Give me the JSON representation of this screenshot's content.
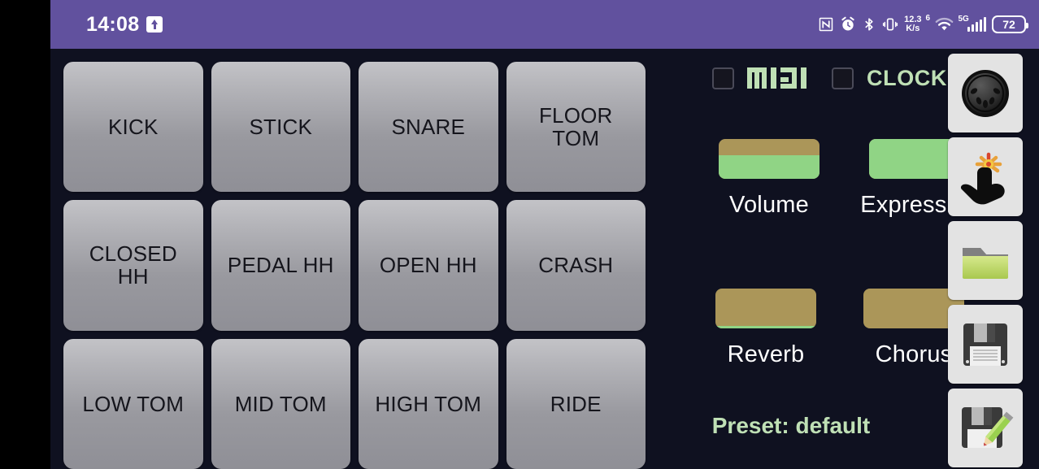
{
  "statusbar": {
    "time": "14:08",
    "upload_icon": "upload-arrow-icon",
    "icons": [
      "nfc-icon",
      "alarm-icon",
      "bluetooth-icon",
      "vibrate-icon"
    ],
    "data_speed_value": "12.3",
    "data_speed_unit": "K/s",
    "wifi_generation": "6",
    "wifi_icon": "wifi-icon",
    "network_generation": "5G",
    "signal_icon": "signal-bars-icon",
    "battery_level": "72"
  },
  "pads": [
    {
      "label": "KICK"
    },
    {
      "label": "STICK"
    },
    {
      "label": "SNARE"
    },
    {
      "label": "FLOOR\nTOM"
    },
    {
      "label": "CLOSED\nHH"
    },
    {
      "label": "PEDAL HH"
    },
    {
      "label": "OPEN HH"
    },
    {
      "label": "CRASH"
    },
    {
      "label": "LOW TOM"
    },
    {
      "label": "MID TOM"
    },
    {
      "label": "HIGH TOM"
    },
    {
      "label": "RIDE"
    }
  ],
  "controls": {
    "midi_checkbox_checked": false,
    "midi_logo_label": "MIDI",
    "clock_checkbox_checked": false,
    "clock_label": "CLOCK",
    "sliders": [
      {
        "label": "Volume",
        "value_percent": 60
      },
      {
        "label": "Expression",
        "value_percent": 100
      },
      {
        "label": "Reverb",
        "value_percent": 7
      },
      {
        "label": "Chorus",
        "value_percent": 0
      }
    ],
    "preset_text": "Preset: default"
  },
  "rail": [
    {
      "icon": "midi-din-port-icon",
      "label": "MIDI Port"
    },
    {
      "icon": "tap-finger-icon",
      "label": "Tap"
    },
    {
      "icon": "open-folder-icon",
      "label": "Open"
    },
    {
      "icon": "floppy-save-icon",
      "label": "Save"
    },
    {
      "icon": "floppy-save-as-icon",
      "label": "Save As"
    }
  ],
  "colors": {
    "statusbar_purple": "#61519e",
    "app_background": "#0f1120",
    "pad_gray": "#b2b2b7",
    "slider_green": "#90d485",
    "slider_tan": "#ab9659",
    "accent_green_text": "#bfe0b5"
  }
}
